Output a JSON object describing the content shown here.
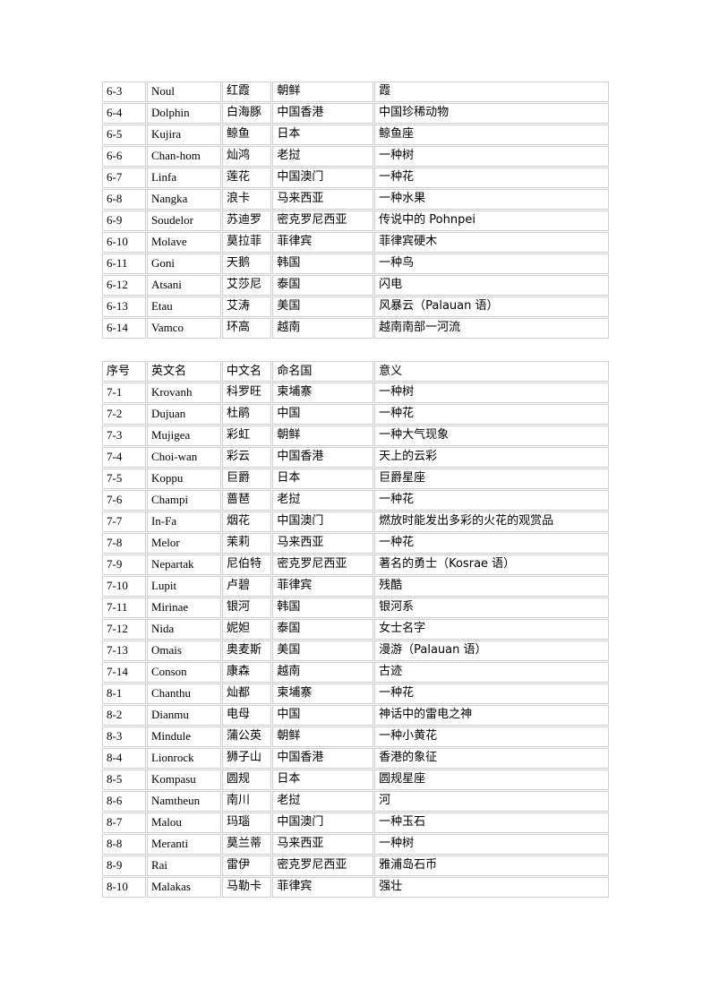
{
  "document": {
    "page_background": "#ffffff",
    "border_color": "#cfcfcf",
    "text_color": "#000000"
  },
  "tables": [
    {
      "name": "table-group-6",
      "has_header": false,
      "columns": [
        "序号",
        "英文名",
        "中文名",
        "命名国",
        "意义"
      ],
      "rows": [
        {
          "no": "6-3",
          "en": "Noul",
          "cn": "红霞",
          "country": "朝鲜",
          "meaning": "霞"
        },
        {
          "no": "6-4",
          "en": "Dolphin",
          "cn": "白海豚",
          "country": "中国香港",
          "meaning": "中国珍稀动物"
        },
        {
          "no": "6-5",
          "en": "Kujira",
          "cn": "鲸鱼",
          "country": "日本",
          "meaning": "鲸鱼座"
        },
        {
          "no": "6-6",
          "en": "Chan-hom",
          "cn": "灿鸿",
          "country": "老挝",
          "meaning": "一种树"
        },
        {
          "no": "6-7",
          "en": "Linfa",
          "cn": "莲花",
          "country": "中国澳门",
          "meaning": "一种花"
        },
        {
          "no": "6-8",
          "en": "Nangka",
          "cn": "浪卡",
          "country": "马来西亚",
          "meaning": "一种水果"
        },
        {
          "no": "6-9",
          "en": "Soudelor",
          "cn": "苏迪罗",
          "country": "密克罗尼西亚",
          "meaning": "传说中的 Pohnpei"
        },
        {
          "no": "6-10",
          "en": "Molave",
          "cn": "莫拉菲",
          "country": "菲律宾",
          "meaning": "菲律宾硬木"
        },
        {
          "no": "6-11",
          "en": "Goni",
          "cn": "天鹅",
          "country": "韩国",
          "meaning": "一种鸟"
        },
        {
          "no": "6-12",
          "en": "Atsani",
          "cn": "艾莎尼",
          "country": "泰国",
          "meaning": "闪电"
        },
        {
          "no": "6-13",
          "en": "Etau",
          "cn": "艾涛",
          "country": "美国",
          "meaning": "风暴云（Palauan 语）"
        },
        {
          "no": "6-14",
          "en": "Vamco",
          "cn": "环高",
          "country": "越南",
          "meaning": "越南南部一河流"
        }
      ]
    },
    {
      "name": "table-group-7-8",
      "has_header": true,
      "columns": [
        "序号",
        "英文名",
        "中文名",
        "命名国",
        "意义"
      ],
      "rows": [
        {
          "no": "7-1",
          "en": "Krovanh",
          "cn": "科罗旺",
          "country": "柬埔寨",
          "meaning": "一种树"
        },
        {
          "no": "7-2",
          "en": "Dujuan",
          "cn": "杜鹃",
          "country": "中国",
          "meaning": "一种花"
        },
        {
          "no": "7-3",
          "en": "Mujigea",
          "cn": "彩虹",
          "country": "朝鲜",
          "meaning": "一种大气现象"
        },
        {
          "no": "7-4",
          "en": "Choi-wan",
          "cn": "彩云",
          "country": "中国香港",
          "meaning": "天上的云彩"
        },
        {
          "no": "7-5",
          "en": "Koppu",
          "cn": "巨爵",
          "country": "日本",
          "meaning": "巨爵星座"
        },
        {
          "no": "7-6",
          "en": "Champi",
          "cn": "蔷琶",
          "country": "老挝",
          "meaning": "一种花"
        },
        {
          "no": "7-7",
          "en": "In-Fa",
          "cn": "烟花",
          "country": "中国澳门",
          "meaning": "燃放时能发出多彩的火花的观赏品"
        },
        {
          "no": "7-8",
          "en": "Melor",
          "cn": "茉莉",
          "country": "马来西亚",
          "meaning": "一种花"
        },
        {
          "no": "7-9",
          "en": "Nepartak",
          "cn": "尼伯特",
          "country": "密克罗尼西亚",
          "meaning": "著名的勇士（Kosrae 语）"
        },
        {
          "no": "7-10",
          "en": "Lupit",
          "cn": "卢碧",
          "country": "菲律宾",
          "meaning": "残酷"
        },
        {
          "no": "7-11",
          "en": "Mirinae",
          "cn": "银河",
          "country": "韩国",
          "meaning": "银河系"
        },
        {
          "no": "7-12",
          "en": "Nida",
          "cn": "妮妲",
          "country": "泰国",
          "meaning": "女士名字"
        },
        {
          "no": "7-13",
          "en": "Omais",
          "cn": "奥麦斯",
          "country": "美国",
          "meaning": "漫游（Palauan 语）"
        },
        {
          "no": "7-14",
          "en": "Conson",
          "cn": "康森",
          "country": "越南",
          "meaning": "古迹"
        },
        {
          "no": "8-1",
          "en": "Chanthu",
          "cn": "灿都",
          "country": "柬埔寨",
          "meaning": "一种花"
        },
        {
          "no": "8-2",
          "en": "Dianmu",
          "cn": "电母",
          "country": "中国",
          "meaning": "神话中的雷电之神"
        },
        {
          "no": "8-3",
          "en": "Mindule",
          "cn": "蒲公英",
          "country": "朝鲜",
          "meaning": "一种小黄花"
        },
        {
          "no": "8-4",
          "en": "Lionrock",
          "cn": "狮子山",
          "country": "中国香港",
          "meaning": "香港的象征"
        },
        {
          "no": "8-5",
          "en": "Kompasu",
          "cn": "圆规",
          "country": "日本",
          "meaning": "圆规星座"
        },
        {
          "no": "8-6",
          "en": "Namtheun",
          "cn": "南川",
          "country": "老挝",
          "meaning": "河"
        },
        {
          "no": "8-7",
          "en": "Malou",
          "cn": "玛瑙",
          "country": "中国澳门",
          "meaning": "一种玉石"
        },
        {
          "no": "8-8",
          "en": "Meranti",
          "cn": "莫兰蒂",
          "country": "马来西亚",
          "meaning": "一种树"
        },
        {
          "no": "8-9",
          "en": "Rai",
          "cn": "雷伊",
          "country": "密克罗尼西亚",
          "meaning": "雅浦岛石币"
        },
        {
          "no": "8-10",
          "en": "Malakas",
          "cn": "马勒卡",
          "country": "菲律宾",
          "meaning": "强壮"
        }
      ]
    }
  ]
}
